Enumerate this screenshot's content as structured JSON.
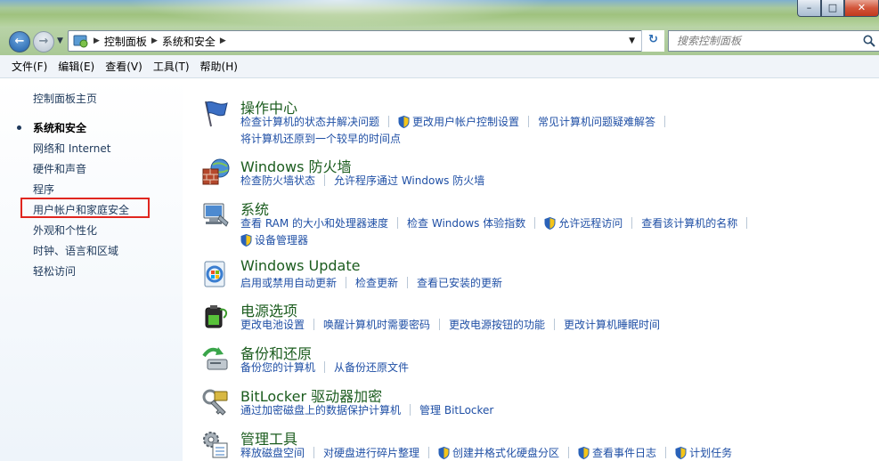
{
  "window": {
    "controls": {
      "minimize": "–",
      "maximize": "□",
      "close": "✕"
    }
  },
  "nav": {
    "back_glyph": "←",
    "forward_glyph": "→",
    "breadcrumb": [
      "控制面板",
      "系统和安全"
    ],
    "refresh_glyph": "↻",
    "search_placeholder": "搜索控制面板"
  },
  "menu": [
    "文件(F)",
    "编辑(E)",
    "查看(V)",
    "工具(T)",
    "帮助(H)"
  ],
  "sidebar": {
    "home": "控制面板主页",
    "items": [
      {
        "label": "系统和安全",
        "active": true
      },
      {
        "label": "网络和 Internet"
      },
      {
        "label": "硬件和声音"
      },
      {
        "label": "程序"
      },
      {
        "label": "用户帐户和家庭安全",
        "highlighted": true
      },
      {
        "label": "外观和个性化"
      },
      {
        "label": "时钟、语言和区域"
      },
      {
        "label": "轻松访问"
      }
    ]
  },
  "categories": [
    {
      "title": "操作中心",
      "icon": "flag-icon",
      "rows": [
        [
          {
            "t": "检查计算机的状态并解决问题"
          },
          {
            "t": "更改用户帐户控制设置",
            "shield": true
          },
          {
            "t": "常见计算机问题疑难解答"
          }
        ],
        [
          {
            "t": "将计算机还原到一个较早的时间点"
          }
        ]
      ]
    },
    {
      "title": "Windows 防火墙",
      "icon": "firewall-icon",
      "rows": [
        [
          {
            "t": "检查防火墙状态"
          },
          {
            "t": "允许程序通过 Windows 防火墙"
          }
        ]
      ]
    },
    {
      "title": "系统",
      "icon": "computer-icon",
      "rows": [
        [
          {
            "t": "查看 RAM 的大小和处理器速度"
          },
          {
            "t": "检查 Windows 体验指数"
          },
          {
            "t": "允许远程访问",
            "shield": true
          },
          {
            "t": "查看该计算机的名称"
          }
        ],
        [
          {
            "t": "设备管理器",
            "shield": true
          }
        ]
      ]
    },
    {
      "title": "Windows Update",
      "icon": "windows-update-icon",
      "rows": [
        [
          {
            "t": "启用或禁用自动更新"
          },
          {
            "t": "检查更新"
          },
          {
            "t": "查看已安装的更新"
          }
        ]
      ]
    },
    {
      "title": "电源选项",
      "icon": "battery-icon",
      "rows": [
        [
          {
            "t": "更改电池设置"
          },
          {
            "t": "唤醒计算机时需要密码"
          },
          {
            "t": "更改电源按钮的功能"
          },
          {
            "t": "更改计算机睡眠时间"
          }
        ]
      ]
    },
    {
      "title": "备份和还原",
      "icon": "backup-icon",
      "rows": [
        [
          {
            "t": "备份您的计算机"
          },
          {
            "t": "从备份还原文件"
          }
        ]
      ]
    },
    {
      "title": "BitLocker 驱动器加密",
      "icon": "bitlocker-icon",
      "rows": [
        [
          {
            "t": "通过加密磁盘上的数据保护计算机"
          },
          {
            "t": "管理 BitLocker"
          }
        ]
      ]
    },
    {
      "title": "管理工具",
      "icon": "admin-tools-icon",
      "rows": [
        [
          {
            "t": "释放磁盘空间"
          },
          {
            "t": "对硬盘进行碎片整理"
          },
          {
            "t": "创建并格式化硬盘分区",
            "shield": true
          },
          {
            "t": "查看事件日志",
            "shield": true
          },
          {
            "t": "计划任务",
            "shield": true
          }
        ]
      ]
    }
  ],
  "colors": {
    "link": "#1f4fa5",
    "category_title": "#1b5c1e",
    "highlight": "#e0261f"
  }
}
